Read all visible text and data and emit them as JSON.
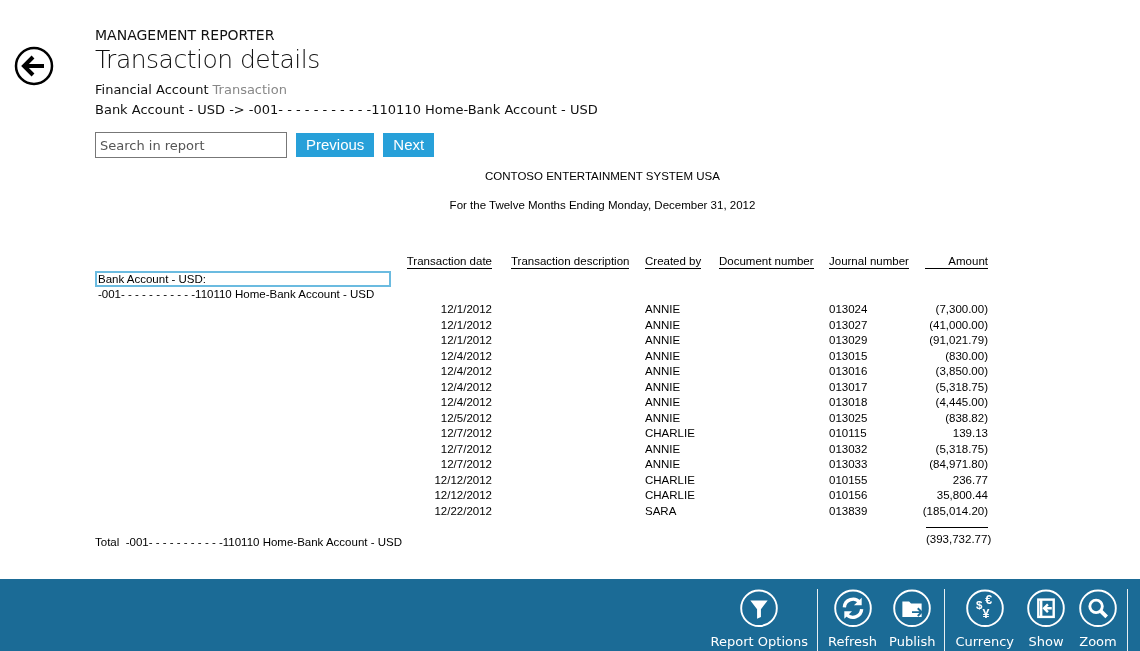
{
  "app_name": "MANAGEMENT REPORTER",
  "title": "Transaction details",
  "breadcrumb": {
    "parent": "Financial Account",
    "current": "Transaction"
  },
  "account_path": "Bank Account - USD -> -001- - - - - - - - - - -110110 Home-Bank Account - USD",
  "search": {
    "placeholder": "Search in report"
  },
  "nav_buttons": [
    "Previous",
    "Next"
  ],
  "report": {
    "company": "CONTOSO ENTERTAINMENT SYSTEM USA",
    "period": "For the Twelve Months Ending Monday, December 31, 2012",
    "columns": [
      "Transaction date",
      "Transaction description",
      "Created by",
      "Document number",
      "Journal number",
      "Amount"
    ],
    "group": {
      "label": "Bank Account - USD:",
      "selected": true
    },
    "account": "-001- - - - - - - - - - -110110 Home-Bank Account - USD",
    "rows": [
      {
        "date": "12/1/2012",
        "created_by": "ANNIE",
        "journal_number": "013024",
        "amount": "(7,300.00)"
      },
      {
        "date": "12/1/2012",
        "created_by": "ANNIE",
        "journal_number": "013027",
        "amount": "(41,000.00)"
      },
      {
        "date": "12/1/2012",
        "created_by": "ANNIE",
        "journal_number": "013029",
        "amount": "(91,021.79)"
      },
      {
        "date": "12/4/2012",
        "created_by": "ANNIE",
        "journal_number": "013015",
        "amount": "(830.00)"
      },
      {
        "date": "12/4/2012",
        "created_by": "ANNIE",
        "journal_number": "013016",
        "amount": "(3,850.00)"
      },
      {
        "date": "12/4/2012",
        "created_by": "ANNIE",
        "journal_number": "013017",
        "amount": "(5,318.75)"
      },
      {
        "date": "12/4/2012",
        "created_by": "ANNIE",
        "journal_number": "013018",
        "amount": "(4,445.00)"
      },
      {
        "date": "12/5/2012",
        "created_by": "ANNIE",
        "journal_number": "013025",
        "amount": "(838.82)"
      },
      {
        "date": "12/7/2012",
        "created_by": "CHARLIE",
        "journal_number": "010115",
        "amount": "139.13"
      },
      {
        "date": "12/7/2012",
        "created_by": "ANNIE",
        "journal_number": "013032",
        "amount": "(5,318.75)"
      },
      {
        "date": "12/7/2012",
        "created_by": "ANNIE",
        "journal_number": "013033",
        "amount": "(84,971.80)"
      },
      {
        "date": "12/12/2012",
        "created_by": "CHARLIE",
        "journal_number": "010155",
        "amount": "236.77"
      },
      {
        "date": "12/12/2012",
        "created_by": "CHARLIE",
        "journal_number": "010156",
        "amount": "35,800.44"
      },
      {
        "date": "12/22/2012",
        "created_by": "SARA",
        "journal_number": "013839",
        "amount": "(185,014.20)"
      }
    ],
    "total": {
      "label": "Total  -001- - - - - - - - - - -110110 Home-Bank Account - USD",
      "amount": "(393,732.77)"
    }
  },
  "toolbar": [
    {
      "label": "Report Options",
      "kind": "filter",
      "divider_after": true
    },
    {
      "label": "Refresh",
      "kind": "refresh",
      "divider_after": false
    },
    {
      "label": "Publish",
      "kind": "publish",
      "divider_after": true
    },
    {
      "label": "Currency",
      "kind": "currency",
      "symbols": [
        "$",
        "€",
        "¥"
      ],
      "divider_after": false
    },
    {
      "label": "Show",
      "kind": "show",
      "divider_after": false
    },
    {
      "label": "Zoom",
      "kind": "zoom",
      "divider_after": true
    }
  ]
}
